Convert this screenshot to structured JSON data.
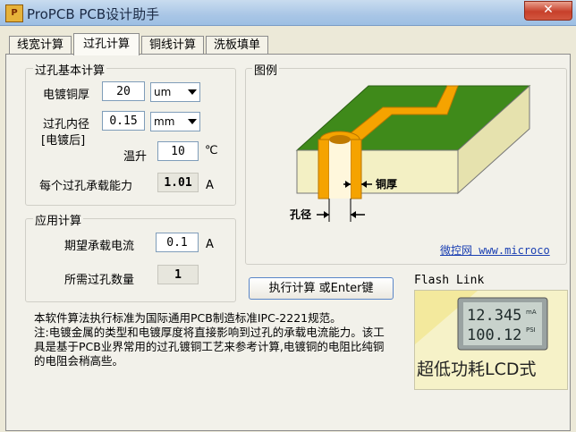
{
  "window": {
    "title": "ProPCB PCB设计助手",
    "icon_glyph": "P",
    "close_glyph": "✕"
  },
  "tabs": [
    {
      "label": "线宽计算",
      "active": false
    },
    {
      "label": "过孔计算",
      "active": true
    },
    {
      "label": "铜线计算",
      "active": false
    },
    {
      "label": "洗板填单",
      "active": false
    }
  ],
  "basic": {
    "title": "过孔基本计算",
    "plating_label": "电镀铜厚",
    "plating_value": "20",
    "plating_unit": "um",
    "diameter_label_1": "过孔内径",
    "diameter_label_2": "[电镀后]",
    "diameter_value": "0.15",
    "diameter_unit": "mm",
    "temp_label": "温升",
    "temp_value": "10",
    "temp_unit": "℃",
    "capacity_label": "每个过孔承载能力",
    "capacity_value": "1.01",
    "capacity_unit": "A"
  },
  "app": {
    "title": "应用计算",
    "current_label": "期望承载电流",
    "current_value": "0.1",
    "current_unit": "A",
    "count_label": "所需过孔数量",
    "count_value": "1"
  },
  "figure": {
    "title": "图例",
    "copper_label": "铜厚",
    "hole_label": "孔径",
    "link_text": "微控网 www.microco"
  },
  "execute_button": "执行计算 或Enter键",
  "note": {
    "line1": "本软件算法执行标准为国际通用PCB制造标准IPC-2221规范。",
    "line2": "注:电镀金属的类型和电镀厚度将直接影响到过孔的承载电流能力。该工具是基于PCB业界常用的过孔镀铜工艺来参考计算,电镀铜的电阻比纯铜的电阻会稍高些。"
  },
  "flash": {
    "title": "Flash Link",
    "lcd_top": "12.345",
    "lcd_top_unit": "mA",
    "lcd_bottom": "100.12",
    "lcd_bottom_unit": "PSI",
    "ad_text": "超低功耗LCD式"
  },
  "colors": {
    "board": "#f3f0c4",
    "copper": "#f5a300",
    "green": "#3f8a1a",
    "link": "#1a3fb2"
  }
}
